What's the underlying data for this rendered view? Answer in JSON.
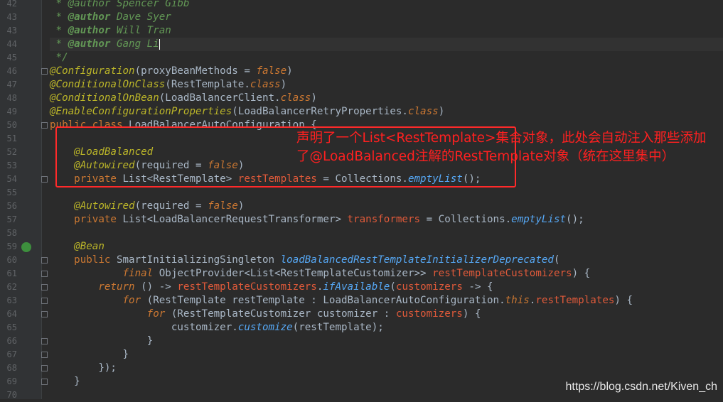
{
  "editor": {
    "line_numbers": [
      "42",
      "43",
      "43",
      "44",
      "45",
      "46",
      "47",
      "48",
      "49",
      "50",
      "51",
      "52",
      "53",
      "54",
      "55",
      "56",
      "57",
      "58",
      "59",
      "60",
      "61",
      "62",
      "63",
      "64",
      "65",
      "66",
      "67",
      "68",
      "69",
      "70"
    ],
    "lines": [
      {
        "n": "42",
        "parts": [
          {
            "t": " * @author Spencer Gibb",
            "c": "tok-doc"
          }
        ]
      },
      {
        "n": "43",
        "parts": [
          {
            "t": " * ",
            "c": "tok-doc"
          },
          {
            "t": "@author",
            "c": "tok-tag"
          },
          {
            "t": " Dave Syer",
            "c": "tok-doc"
          }
        ]
      },
      {
        "n": "43",
        "parts": [
          {
            "t": " * ",
            "c": "tok-doc"
          },
          {
            "t": "@author",
            "c": "tok-tag"
          },
          {
            "t": " Will Tran",
            "c": "tok-doc"
          }
        ]
      },
      {
        "n": "44",
        "parts": [
          {
            "t": " * ",
            "c": "tok-doc"
          },
          {
            "t": "@author",
            "c": "tok-tag"
          },
          {
            "t": " Gang Li",
            "c": "tok-doc"
          }
        ],
        "caret": true,
        "current": true
      },
      {
        "n": "45",
        "parts": [
          {
            "t": " */",
            "c": "tok-doc"
          }
        ]
      },
      {
        "n": "46",
        "parts": [
          {
            "t": "@Configuration",
            "c": "tok-ann"
          },
          {
            "t": "(",
            "c": "tok-plain"
          },
          {
            "t": "proxyBeanMethods",
            "c": "tok-plain"
          },
          {
            "t": " = ",
            "c": "tok-plain"
          },
          {
            "t": "false",
            "c": "tok-kwi"
          },
          {
            "t": ")",
            "c": "tok-plain"
          }
        ]
      },
      {
        "n": "47",
        "parts": [
          {
            "t": "@ConditionalOnClass",
            "c": "tok-ann"
          },
          {
            "t": "(RestTemplate.",
            "c": "tok-plain"
          },
          {
            "t": "class",
            "c": "tok-kwi"
          },
          {
            "t": ")",
            "c": "tok-plain"
          }
        ]
      },
      {
        "n": "48",
        "parts": [
          {
            "t": "@ConditionalOnBean",
            "c": "tok-ann"
          },
          {
            "t": "(LoadBalancerClient.",
            "c": "tok-plain"
          },
          {
            "t": "class",
            "c": "tok-kwi"
          },
          {
            "t": ")",
            "c": "tok-plain"
          }
        ]
      },
      {
        "n": "49",
        "parts": [
          {
            "t": "@EnableConfigurationProperties",
            "c": "tok-ann"
          },
          {
            "t": "(LoadBalancerRetryProperties.",
            "c": "tok-plain"
          },
          {
            "t": "class",
            "c": "tok-kwi"
          },
          {
            "t": ")",
            "c": "tok-plain"
          }
        ]
      },
      {
        "n": "50",
        "parts": [
          {
            "t": "public class ",
            "c": "tok-kw"
          },
          {
            "t": "LoadBalancerAutoConfiguration {",
            "c": "tok-plain"
          }
        ]
      },
      {
        "n": "51",
        "parts": []
      },
      {
        "n": "52",
        "parts": [
          {
            "t": "    @LoadBalanced",
            "c": "tok-ann"
          }
        ]
      },
      {
        "n": "53",
        "parts": [
          {
            "t": "    @Autowired",
            "c": "tok-ann"
          },
          {
            "t": "(required = ",
            "c": "tok-plain"
          },
          {
            "t": "false",
            "c": "tok-kwi"
          },
          {
            "t": ")",
            "c": "tok-plain"
          }
        ]
      },
      {
        "n": "54",
        "parts": [
          {
            "t": "    private ",
            "c": "tok-kw"
          },
          {
            "t": "List<RestTemplate> ",
            "c": "tok-plain"
          },
          {
            "t": "restTemplates",
            "c": "tok-red"
          },
          {
            "t": " = Collections.",
            "c": "tok-plain"
          },
          {
            "t": "emptyList",
            "c": "tok-italic-method"
          },
          {
            "t": "();",
            "c": "tok-plain"
          }
        ]
      },
      {
        "n": "55",
        "parts": []
      },
      {
        "n": "56",
        "parts": [
          {
            "t": "    @Autowired",
            "c": "tok-ann"
          },
          {
            "t": "(required = ",
            "c": "tok-plain"
          },
          {
            "t": "false",
            "c": "tok-kwi"
          },
          {
            "t": ")",
            "c": "tok-plain"
          }
        ]
      },
      {
        "n": "57",
        "parts": [
          {
            "t": "    private ",
            "c": "tok-kw"
          },
          {
            "t": "List<LoadBalancerRequestTransformer> ",
            "c": "tok-plain"
          },
          {
            "t": "transformers",
            "c": "tok-red"
          },
          {
            "t": " = Collections.",
            "c": "tok-plain"
          },
          {
            "t": "emptyList",
            "c": "tok-italic-method"
          },
          {
            "t": "();",
            "c": "tok-plain"
          }
        ]
      },
      {
        "n": "58",
        "parts": []
      },
      {
        "n": "59",
        "parts": [
          {
            "t": "    @Bean",
            "c": "tok-ann"
          }
        ]
      },
      {
        "n": "60",
        "parts": [
          {
            "t": "    public ",
            "c": "tok-kw"
          },
          {
            "t": "SmartInitializingSingleton ",
            "c": "tok-plain"
          },
          {
            "t": "loadBalancedRestTemplateInitializerDeprecated",
            "c": "tok-italic-method"
          },
          {
            "t": "(",
            "c": "tok-plain"
          }
        ]
      },
      {
        "n": "61",
        "parts": [
          {
            "t": "            final ",
            "c": "tok-kwi"
          },
          {
            "t": "ObjectProvider<List<RestTemplateCustomizer>> ",
            "c": "tok-plain"
          },
          {
            "t": "restTemplateCustomizers",
            "c": "tok-red"
          },
          {
            "t": ") {",
            "c": "tok-plain"
          }
        ]
      },
      {
        "n": "62",
        "parts": [
          {
            "t": "        return ",
            "c": "tok-kwi"
          },
          {
            "t": "() -> ",
            "c": "tok-plain"
          },
          {
            "t": "restTemplateCustomizers",
            "c": "tok-red"
          },
          {
            "t": ".",
            "c": "tok-plain"
          },
          {
            "t": "ifAvailable",
            "c": "tok-italic-method"
          },
          {
            "t": "(",
            "c": "tok-plain"
          },
          {
            "t": "customizers",
            "c": "tok-red"
          },
          {
            "t": " -> {",
            "c": "tok-plain"
          }
        ]
      },
      {
        "n": "63",
        "parts": [
          {
            "t": "            for ",
            "c": "tok-kwi"
          },
          {
            "t": "(RestTemplate restTemplate : LoadBalancerAutoConfiguration.",
            "c": "tok-plain"
          },
          {
            "t": "this",
            "c": "tok-kwi"
          },
          {
            "t": ".",
            "c": "tok-plain"
          },
          {
            "t": "restTemplates",
            "c": "tok-red"
          },
          {
            "t": ") {",
            "c": "tok-plain"
          }
        ]
      },
      {
        "n": "64",
        "parts": [
          {
            "t": "                for ",
            "c": "tok-kwi"
          },
          {
            "t": "(RestTemplateCustomizer customizer : ",
            "c": "tok-plain"
          },
          {
            "t": "customizers",
            "c": "tok-red"
          },
          {
            "t": ") {",
            "c": "tok-plain"
          }
        ]
      },
      {
        "n": "65",
        "parts": [
          {
            "t": "                    customizer.",
            "c": "tok-plain"
          },
          {
            "t": "customize",
            "c": "tok-italic-method"
          },
          {
            "t": "(restTemplate);",
            "c": "tok-plain"
          }
        ]
      },
      {
        "n": "66",
        "parts": [
          {
            "t": "                }",
            "c": "tok-plain"
          }
        ]
      },
      {
        "n": "67",
        "parts": [
          {
            "t": "            }",
            "c": "tok-plain"
          }
        ]
      },
      {
        "n": "68",
        "parts": [
          {
            "t": "        });",
            "c": "tok-plain"
          }
        ]
      },
      {
        "n": "69",
        "parts": [
          {
            "t": "    }",
            "c": "tok-plain"
          }
        ]
      },
      {
        "n": "70",
        "parts": []
      }
    ]
  },
  "annotation": {
    "text": "声明了一个List<RestTemplate>集合对象，此处会自动注入那些添加了@LoadBalanced注解的RestTemplate对象（统在这里集中）"
  },
  "watermark": "https://blog.csdn.net/Kiven_ch",
  "colors": {
    "background": "#2b2b2b",
    "annotation_red": "#ff2020",
    "keyword": "#cc7832",
    "annotation_yellow": "#bbb529",
    "field_red": "#e05a3a"
  }
}
